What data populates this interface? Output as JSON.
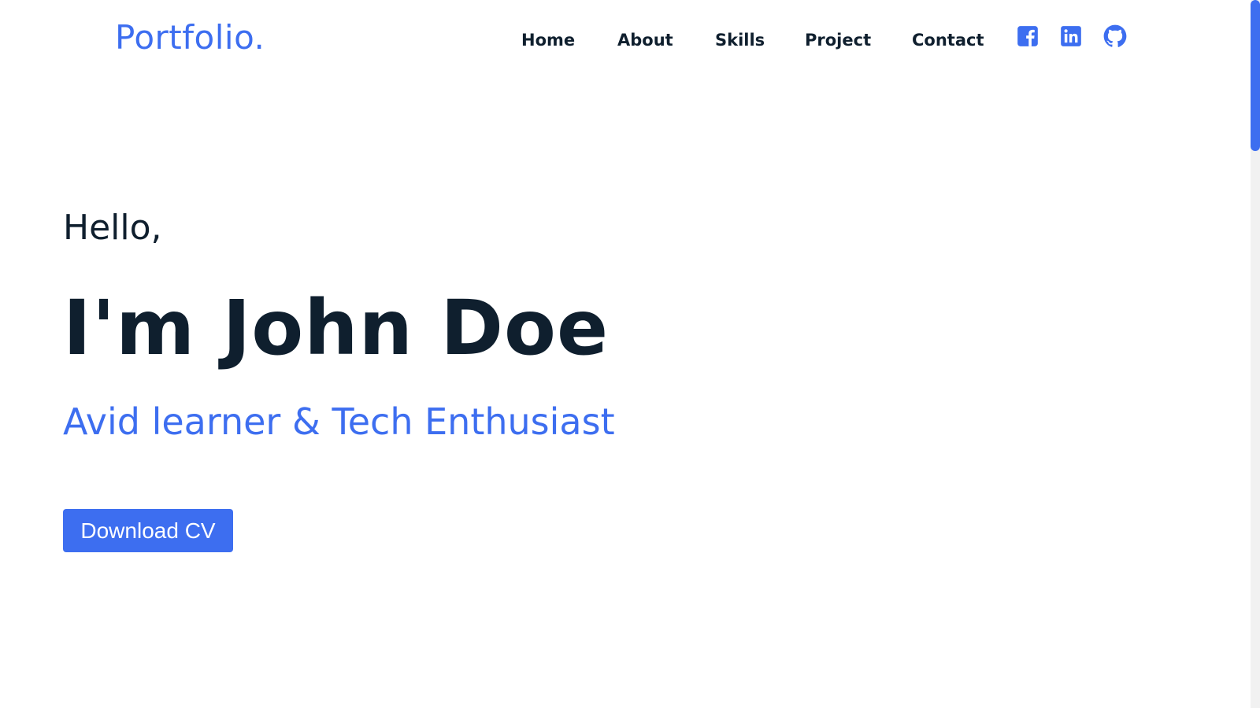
{
  "header": {
    "logo": "Portfolio.",
    "nav": [
      {
        "label": "Home"
      },
      {
        "label": "About"
      },
      {
        "label": "Skills"
      },
      {
        "label": "Project"
      },
      {
        "label": "Contact"
      }
    ],
    "social": [
      {
        "icon": "facebook-icon"
      },
      {
        "icon": "linkedin-icon"
      },
      {
        "icon": "github-icon"
      }
    ]
  },
  "hero": {
    "greeting": "Hello,",
    "name": "I'm John Doe",
    "tagline": "Avid learner & Tech Enthusiast",
    "cta_label": "Download CV"
  },
  "scroll": {
    "position_fraction": 0
  },
  "colors": {
    "accent": "#3d6ef0",
    "text_dark": "#0f1f2e",
    "background": "#ffffff",
    "scrollbar_track": "#f1f1f1"
  }
}
